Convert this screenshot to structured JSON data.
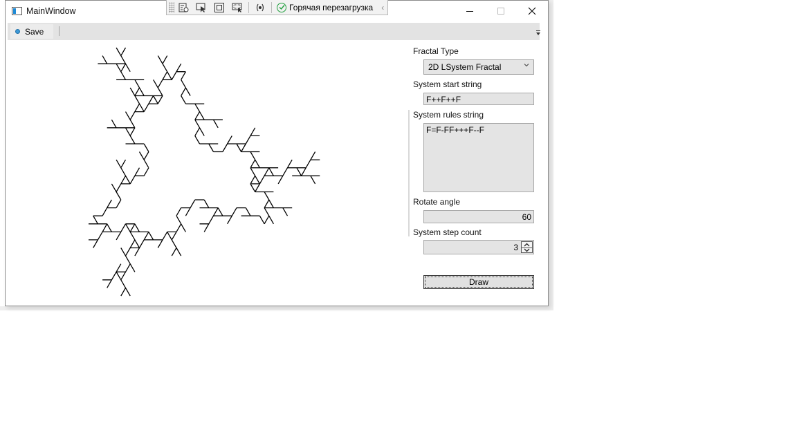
{
  "window": {
    "title": "MainWindow",
    "icon": "app-window-icon",
    "controls": [
      "minimize-icon",
      "maximize-icon",
      "close-icon"
    ]
  },
  "debug_toolbar": {
    "icons": [
      "visual-tree-icon",
      "select-element-icon",
      "display-adorners-icon",
      "track-focus-icon",
      "binding-failures-icon"
    ],
    "hot_reload_label": "Горячая перезагрузка",
    "hot_reload_status_icon": "check-circle-icon",
    "collapse_icon": "chevron-left-icon"
  },
  "menu": {
    "save_label": "Save",
    "save_icon": "dot-icon"
  },
  "form": {
    "fractal_type_label": "Fractal Type",
    "fractal_type_value": "2D LSystem Fractal",
    "start_label": "System start string",
    "start_value": "F++F++F",
    "rules_label": "System rules string",
    "rules_value": "F=F-FF+++F--F",
    "angle_label": "Rotate angle",
    "angle_value": "60",
    "steps_label": "System step count",
    "steps_value": "3",
    "draw_label": "Draw"
  },
  "fractal": {
    "axiom": "F++F++F",
    "rule": "F=F-FF+++F--F",
    "angle_deg": 60,
    "steps": 3,
    "stroke_color": "#000000"
  }
}
